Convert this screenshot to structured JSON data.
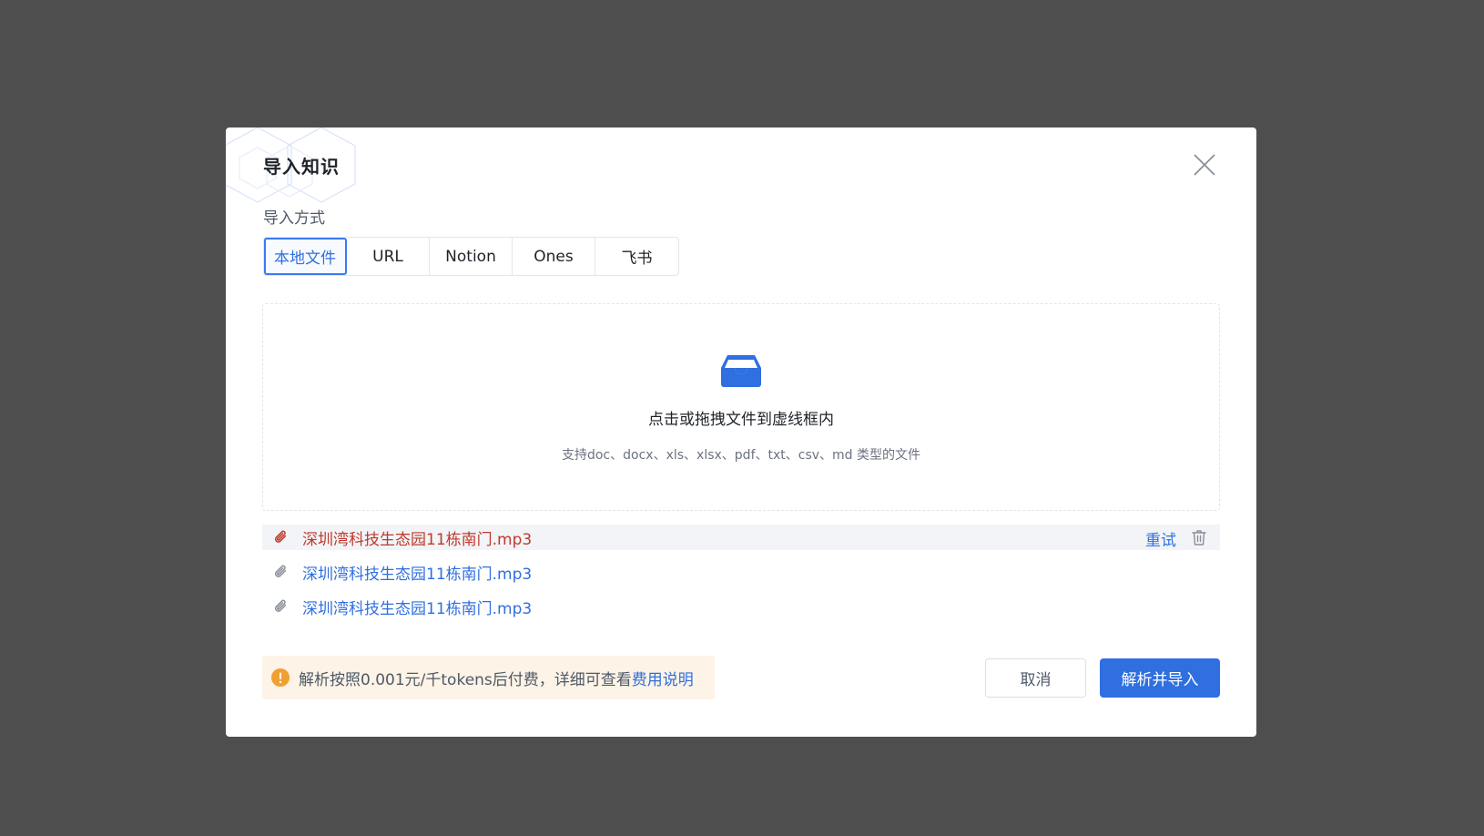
{
  "dialog": {
    "title": "导入知识",
    "method_label": "导入方式",
    "tabs": [
      {
        "label": "本地文件",
        "active": true
      },
      {
        "label": "URL",
        "active": false
      },
      {
        "label": "Notion",
        "active": false
      },
      {
        "label": "Ones",
        "active": false
      },
      {
        "label": "飞书",
        "active": false
      }
    ]
  },
  "dropzone": {
    "icon": "inbox-icon",
    "title": "点击或拖拽文件到虚线框内",
    "subtitle": "支持doc、docx、xls、xlsx、pdf、txt、csv、md 类型的文件"
  },
  "files": [
    {
      "name": "深圳湾科技生态园11栋南门.mp3",
      "status": "error",
      "retry_label": "重试"
    },
    {
      "name": "深圳湾科技生态园11栋南门.mp3",
      "status": "ok"
    },
    {
      "name": "深圳湾科技生态园11栋南门.mp3",
      "status": "ok"
    }
  ],
  "notice": {
    "text": "解析按照0.001元/千tokens后付费，详细可查看",
    "link": "费用说明"
  },
  "buttons": {
    "cancel": "取消",
    "submit": "解析并导入"
  },
  "colors": {
    "accent": "#2f6fe0",
    "error": "#c0392b",
    "warning": "#f0a030",
    "overlay": "#4e4e4e"
  }
}
